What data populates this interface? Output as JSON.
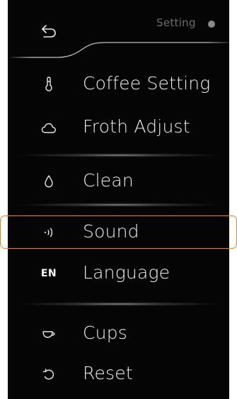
{
  "header": {
    "title": "Setting",
    "back_icon": "back-arrow-icon"
  },
  "menu": {
    "items": [
      {
        "label": "Coffee Setting",
        "icon": "thermometer-icon"
      },
      {
        "label": "Froth Adjust",
        "icon": "cloud-icon"
      },
      {
        "label": "Clean",
        "icon": "droplet-icon"
      },
      {
        "label": "Sound",
        "icon": "sound-icon"
      },
      {
        "label": "Language",
        "icon": "EN"
      },
      {
        "label": "Cups",
        "icon": "cup-icon"
      },
      {
        "label": "Reset",
        "icon": "reset-icon"
      }
    ]
  },
  "colors": {
    "background": "#050505",
    "text": "#ededed",
    "selection_outline": "#d28a3c",
    "title": "#6c6c6c"
  },
  "selected_item": "Sound"
}
